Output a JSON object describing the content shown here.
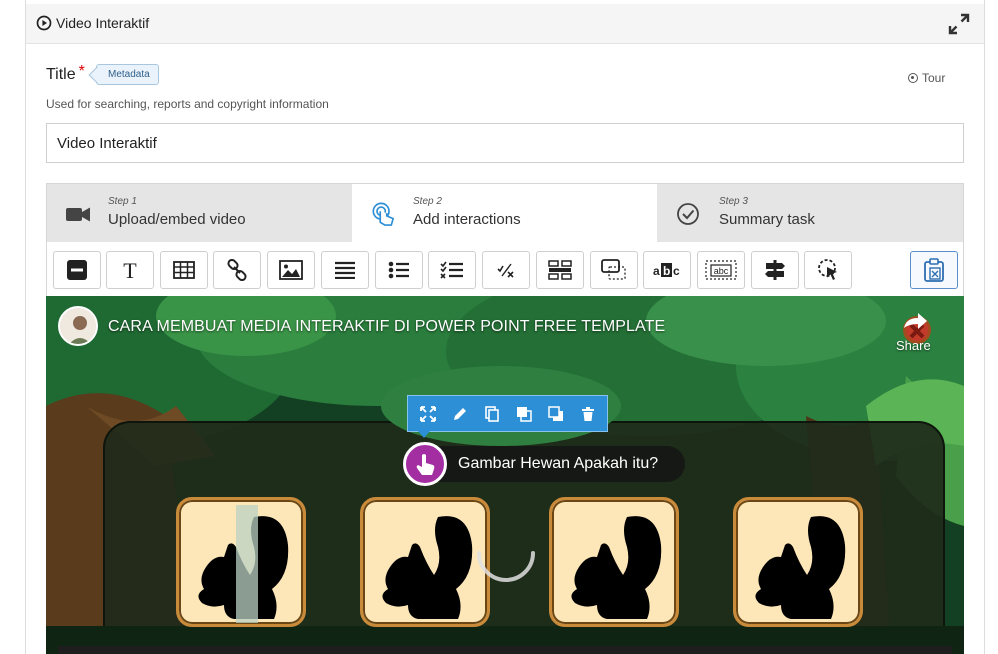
{
  "panel": {
    "title": "Video Interaktif",
    "header_icon": "play-circle-icon",
    "expand_icon": "expand-icon"
  },
  "form": {
    "title_label": "Title",
    "required_mark": "*",
    "metadata_label": "Metadata",
    "tour_label": "Tour",
    "help_text": "Used for searching, reports and copyright information",
    "title_value": "Video Interaktif"
  },
  "steps": [
    {
      "step": "Step 1",
      "label": "Upload/embed video",
      "icon": "video-camera-icon",
      "active": false
    },
    {
      "step": "Step 2",
      "label": "Add interactions",
      "icon": "touch-hand-icon",
      "active": true
    },
    {
      "step": "Step 3",
      "label": "Summary task",
      "icon": "check-circle-icon",
      "active": false
    }
  ],
  "toolbar": {
    "buttons": [
      "label",
      "text",
      "table",
      "link",
      "image",
      "statements",
      "single-choice",
      "multiple-choice",
      "fill-in-blanks",
      "drag-and-drop",
      "mark-the-words",
      "drag-text",
      "crossroads",
      "navigation-hotspot"
    ],
    "paste_button": "paste"
  },
  "video": {
    "title": "CARA MEMBUAT MEDIA INTERAKTIF DI POWER POINT FREE TEMPLATE",
    "share_label": "Share",
    "question_text": "Gambar Hewan Apakah itu?",
    "interaction_actions": [
      "resize",
      "edit",
      "copy",
      "bring-to-front",
      "send-to-back",
      "delete"
    ]
  },
  "colors": {
    "accent_blue": "#2d8fd6",
    "interaction_purple": "#a32ea2",
    "card_fill": "#fde7b9",
    "card_border": "#c98a3a"
  }
}
